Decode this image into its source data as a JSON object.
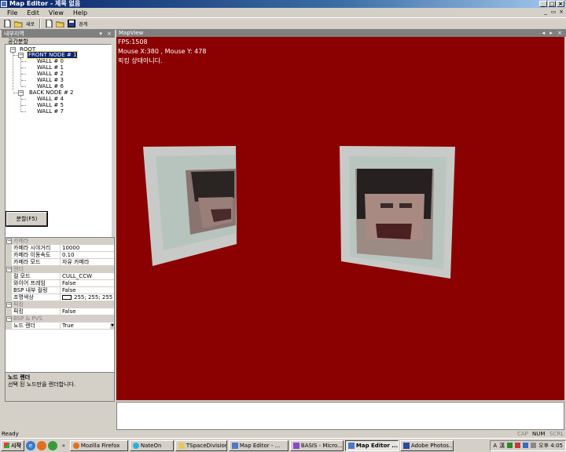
{
  "window": {
    "title": "Map Editor - 제목 없음"
  },
  "menu": [
    "File",
    "Edit",
    "View",
    "Help"
  ],
  "toolbar": {
    "text_buttons": [
      "새로",
      "경계"
    ]
  },
  "left_panel": {
    "title": "내부지역",
    "group_label": "공간분할",
    "tree": {
      "root": "ROOT",
      "front": "FRONT NODE # 1",
      "front_walls": [
        "WALL # 0",
        "WALL # 1",
        "WALL # 2",
        "WALL # 3",
        "WALL # 6"
      ],
      "back": "BACK NODE # 2",
      "back_walls": [
        "WALL # 4",
        "WALL # 5",
        "WALL # 7"
      ]
    },
    "split_button": "분할(F5)"
  },
  "properties": {
    "categories": {
      "camera": "카메라",
      "render": "렌더",
      "picking": "픽킹",
      "bsp": "BSP & PVS"
    },
    "camera_rows": [
      {
        "name": "카메라 시야거리",
        "value": "10000"
      },
      {
        "name": "카메라 이동속도",
        "value": "0.10"
      },
      {
        "name": "카메라 모드",
        "value": "자유 카메라"
      }
    ],
    "render_rows": [
      {
        "name": "컬 모드",
        "value": "CULL_CCW"
      },
      {
        "name": "와이어 프레임",
        "value": "False"
      },
      {
        "name": "BSP 내부 컬링",
        "value": "False"
      },
      {
        "name": "조명색상",
        "value": "255; 255; 255"
      }
    ],
    "picking_rows": [
      {
        "name": "픽킹",
        "value": "False"
      }
    ],
    "bsp_rows": [
      {
        "name": "노드 렌더",
        "value": "True"
      }
    ]
  },
  "description": {
    "title": "노드 렌더",
    "text": "선택 된 노드만을 렌더합니다."
  },
  "mapview": {
    "title": "MapView",
    "fps": "FPS:1508",
    "mouse": "Mouse X:380 , Mouse Y: 478",
    "status": "픽킹 상태아니다.",
    "background": "#8b0000"
  },
  "statusbar": {
    "text": "Ready",
    "indicators": [
      "CAP",
      "NUM",
      "SCRL"
    ]
  },
  "taskbar": {
    "start": "시작",
    "tasks": [
      "Mozilla Firefox",
      "NateOn",
      "TSpaceDivision",
      "Map Editor - ...",
      "BASIS - Micro...",
      "Map Editor ...",
      "Adobe Photos..."
    ],
    "active_task_index": 5,
    "tray_text": [
      "A",
      "漢"
    ],
    "clock": "오후 4:05"
  }
}
